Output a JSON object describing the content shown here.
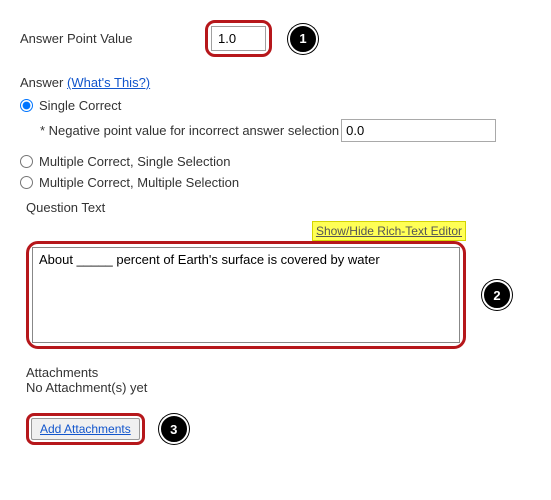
{
  "point": {
    "label": "Answer Point Value",
    "value": "1.0"
  },
  "callouts": {
    "one": "1",
    "two": "2",
    "three": "3"
  },
  "answer": {
    "label": "Answer",
    "whats_this": "(What's This?)",
    "single_correct": "Single Correct",
    "neg_label": "* Negative point value for incorrect answer selection",
    "neg_value": "0.0",
    "multi_single": "Multiple Correct, Single Selection",
    "multi_multi": "Multiple Correct, Multiple Selection"
  },
  "question": {
    "label": "Question Text",
    "toggle": "Show/Hide Rich-Text Editor",
    "text": "About _____ percent of Earth's surface is covered by water"
  },
  "attachments": {
    "heading": "Attachments",
    "none": "No Attachment(s) yet",
    "button": "Add Attachments"
  }
}
